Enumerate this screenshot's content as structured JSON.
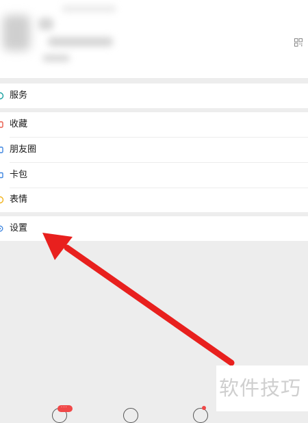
{
  "menu": {
    "services": {
      "label": "服务",
      "icon": "services-icon",
      "icon_color": "#18a0a0"
    },
    "favorites": {
      "label": "收藏",
      "icon": "favorites-icon",
      "icon_color": "#e85a4a"
    },
    "moments": {
      "label": "朋友圈",
      "icon": "moments-icon",
      "icon_color": "#3f86e0"
    },
    "cards": {
      "label": "卡包",
      "icon": "cards-icon",
      "icon_color": "#3f86e0"
    },
    "stickers": {
      "label": "表情",
      "icon": "stickers-icon",
      "icon_color": "#f2b31b"
    },
    "settings": {
      "label": "设置",
      "icon": "settings-icon",
      "icon_color": "#3f86e0"
    }
  },
  "profile": {
    "qr_icon": "qr-code-icon"
  },
  "tabbar": {
    "badge_text": "···"
  },
  "watermark": {
    "text": "软件技巧"
  },
  "colors": {
    "arrow": "#e8201e",
    "background": "#ededed",
    "badge": "#f04848"
  }
}
